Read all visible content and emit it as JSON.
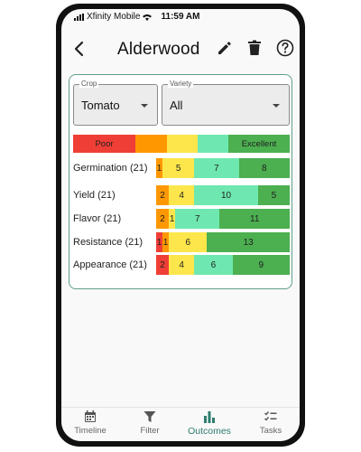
{
  "status_bar": {
    "carrier": "Xfinity Mobile",
    "time": "11:59 AM"
  },
  "header": {
    "title": "Alderwood",
    "icons": [
      "back-arrow-icon",
      "pencil-icon",
      "trash-icon",
      "help-circle-icon"
    ]
  },
  "filters": {
    "crop": {
      "label": "Crop",
      "value": "Tomato"
    },
    "variety": {
      "label": "Variety",
      "value": "All"
    }
  },
  "rating_scale": {
    "low_label": "Poor",
    "high_label": "Excellent",
    "colors": [
      "#ef3e36",
      "#ff9800",
      "#fde64b",
      "#6ee8b0",
      "#4caf50"
    ]
  },
  "outcomes": [
    {
      "label": "Germination (21)",
      "counts": [
        0,
        1,
        5,
        7,
        8
      ]
    },
    {
      "label": "Yield (21)",
      "counts": [
        0,
        2,
        4,
        10,
        5
      ]
    },
    {
      "label": "Flavor (21)",
      "counts": [
        0,
        2,
        1,
        7,
        11
      ]
    },
    {
      "label": "Resistance (21)",
      "counts": [
        1,
        1,
        6,
        0,
        13
      ]
    },
    {
      "label": "Appearance (21)",
      "counts": [
        2,
        0,
        4,
        6,
        9
      ]
    }
  ],
  "nav": {
    "active": "Outcomes",
    "items": [
      {
        "label": "Timeline",
        "icon": "calendar-icon"
      },
      {
        "label": "Filter",
        "icon": "filter-icon"
      },
      {
        "label": "Outcomes",
        "icon": "bar-chart-icon"
      },
      {
        "label": "Tasks",
        "icon": "checklist-icon"
      }
    ]
  }
}
